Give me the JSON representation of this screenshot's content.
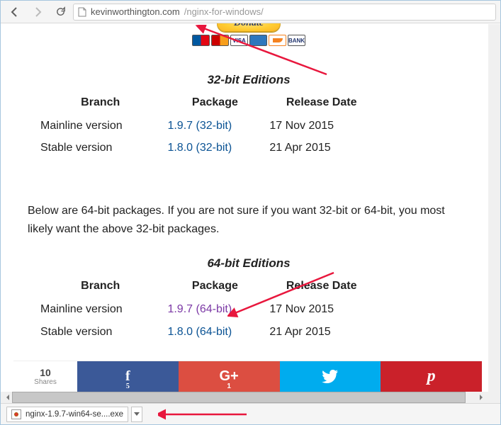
{
  "browser": {
    "url_host": "kevinworthington.com",
    "url_path": "/nginx-for-windows/"
  },
  "donate": {
    "label": "Donate"
  },
  "cc_labels": {
    "visa": "VISA",
    "bank": "BANK"
  },
  "table_headers": {
    "branch": "Branch",
    "package": "Package",
    "release": "Release Date"
  },
  "editions32": {
    "caption": "32-bit Editions",
    "rows": [
      {
        "branch": "Mainline version",
        "package": "1.9.7 (32-bit)",
        "date": "17 Nov 2015"
      },
      {
        "branch": "Stable version",
        "package": "1.8.0 (32-bit)",
        "date": "21 Apr 2015"
      }
    ]
  },
  "note": "Below are 64-bit packages. If you are not sure if you want 32-bit or 64-bit, you most likely want the above 32-bit packages.",
  "editions64": {
    "caption": "64-bit Editions",
    "rows": [
      {
        "branch": "Mainline version",
        "package": "1.9.7 (64-bit)",
        "date": "17 Nov 2015"
      },
      {
        "branch": "Stable version",
        "package": "1.8.0 (64-bit)",
        "date": "21 Apr 2015"
      }
    ]
  },
  "shares": {
    "total": "10",
    "total_label": "Shares",
    "fb_count": "5",
    "gp_count": "1"
  },
  "download": {
    "filename": "nginx-1.9.7-win64-se....exe"
  }
}
